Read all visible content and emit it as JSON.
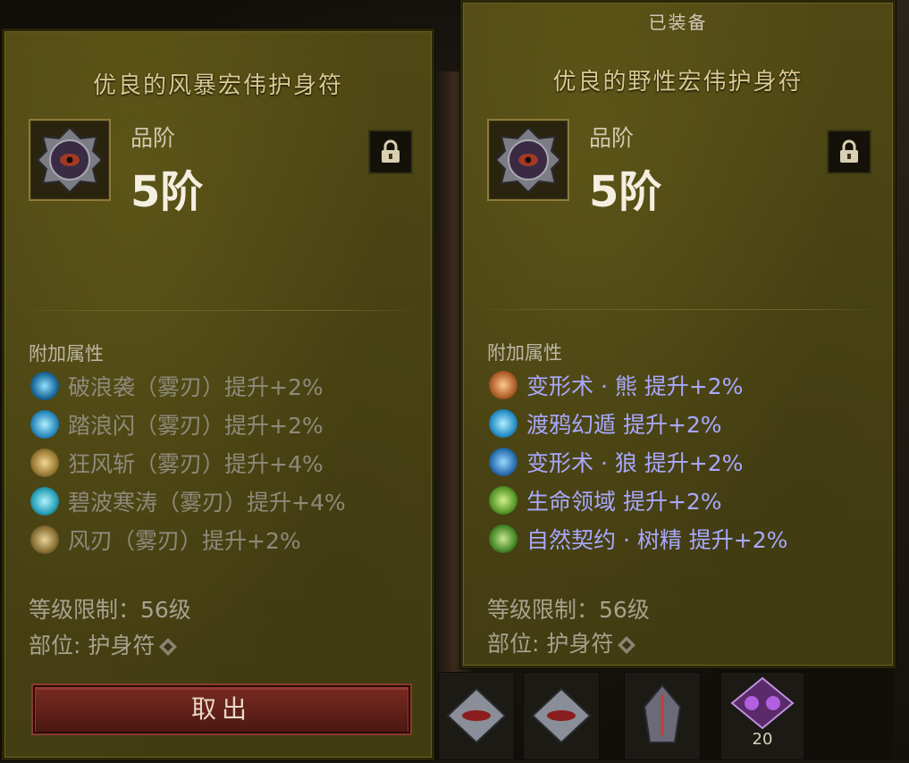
{
  "left_panel": {
    "title": "优良的风暴宏伟护身符",
    "tier_label": "品阶",
    "tier_value": "5阶",
    "affix_header": "附加属性",
    "affixes": [
      {
        "text": "破浪袭（雾刃）提升+2%",
        "icon": "wave-strike-icon",
        "color": "#2f9bd0"
      },
      {
        "text": "踏浪闪（雾刃）提升+2%",
        "icon": "wave-step-icon",
        "color": "#3ab6e0"
      },
      {
        "text": "狂风斩（雾刃）提升+4%",
        "icon": "gale-slash-icon",
        "color": "#c8a24a"
      },
      {
        "text": "碧波寒涛（雾刃）提升+4%",
        "icon": "frost-wave-icon",
        "color": "#3ac0d8"
      },
      {
        "text": "风刃（雾刃）提升+2%",
        "icon": "wind-blade-icon",
        "color": "#b89a4a"
      }
    ],
    "level_req": "等级限制：56级",
    "slot": "部位: 护身符",
    "takeout_label": "取出"
  },
  "right_panel": {
    "equipped_label": "已装备",
    "title": "优良的野性宏伟护身符",
    "tier_label": "品阶",
    "tier_value": "5阶",
    "affix_header": "附加属性",
    "affixes": [
      {
        "text": "变形术 · 熊  提升+2%",
        "icon": "bear-form-icon",
        "color": "#d0782a"
      },
      {
        "text": "渡鸦幻遁  提升+2%",
        "icon": "raven-icon",
        "color": "#3ab0e0"
      },
      {
        "text": "变形术 · 狼  提升+2%",
        "icon": "wolf-form-icon",
        "color": "#2f8fd0"
      },
      {
        "text": "生命领域  提升+2%",
        "icon": "life-field-icon",
        "color": "#7ac040"
      },
      {
        "text": "自然契约 · 树精  提升+2%",
        "icon": "treant-icon",
        "color": "#6ab040"
      }
    ],
    "level_req": "等级限制：56级",
    "slot": "部位: 护身符"
  },
  "inventory": {
    "stack_count": "20"
  }
}
